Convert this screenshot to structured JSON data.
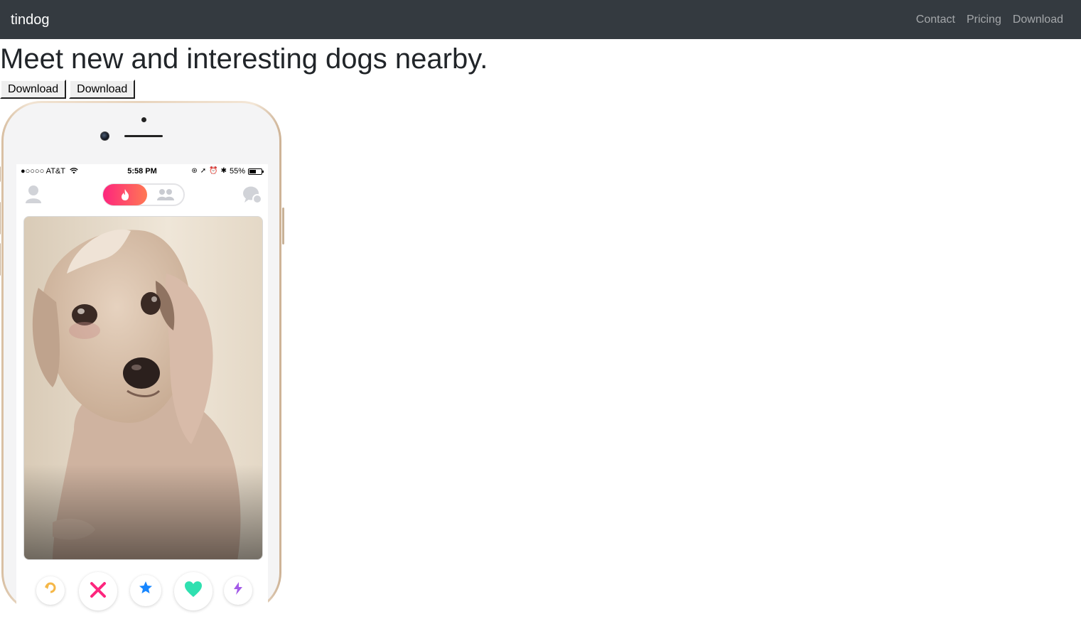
{
  "navbar": {
    "brand": "tindog",
    "links": [
      "Contact",
      "Pricing",
      "Download"
    ]
  },
  "hero": {
    "headline": "Meet new and interesting dogs nearby.",
    "buttons": [
      "Download",
      "Download"
    ]
  },
  "phone": {
    "status_bar": {
      "carrier": "●○○○○ AT&T",
      "time": "5:58 PM",
      "battery": "55%",
      "battery_level": 0.55
    },
    "icons": {
      "profile": "profile-icon",
      "flame": "flame-icon",
      "group": "group-icon",
      "chat": "chat-icon"
    },
    "card": {
      "subject": "dog-photo"
    },
    "colors": {
      "flame_gradient_start": "#fd267d",
      "flame_gradient_end": "#ff7854",
      "rewind": "#f5b748",
      "nope": "#fd267d",
      "superlike": "#1786ff",
      "like": "#2fe0b0",
      "boost": "#a35ae8"
    }
  }
}
